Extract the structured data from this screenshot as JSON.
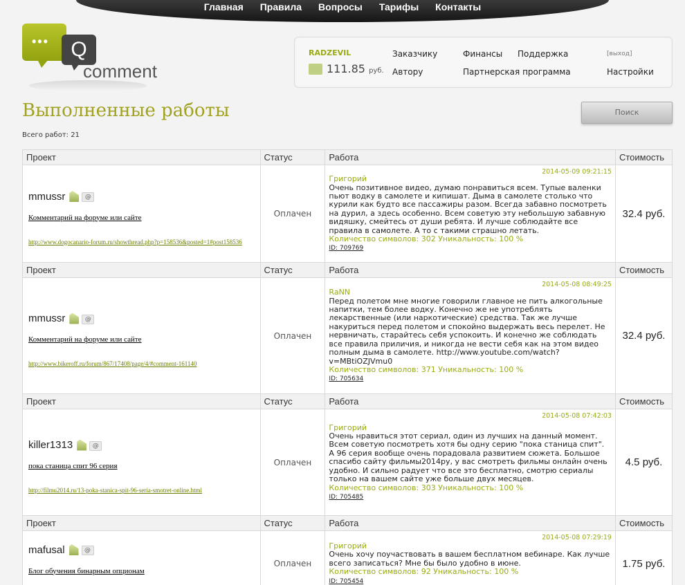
{
  "nav": [
    "Главная",
    "Правила",
    "Вопросы",
    "Тарифы",
    "Контакты"
  ],
  "logo": {
    "letter": "Q",
    "word": "comment",
    "dots": "•••"
  },
  "user": {
    "name": "RADZEVIL",
    "balance": "111.85",
    "currency": "руб.",
    "links": {
      "customer": "Заказчику",
      "author": "Автору",
      "finance": "Финансы",
      "partner": "Партнерская программа",
      "support": "Поддержка",
      "exit": "[выход]",
      "settings": "Настройки"
    }
  },
  "page": {
    "title": "Выполненные работы",
    "search_button": "Поиск",
    "total": "Всего работ: 21"
  },
  "headers": {
    "project": "Проект",
    "status": "Статус",
    "work": "Работа",
    "cost": "Стоимость"
  },
  "rows": [
    {
      "user": "mmussr",
      "title": "Комментарий на форуме или сайте",
      "link": "http://www.dogocanario-forum.ru/showthread.php?p=158536&posted=1#post158536",
      "status": "Оплачен",
      "author": "Григорий",
      "date": "2014-05-09 09:21:15",
      "text": "Очень позитивное видео, думаю понравиться всем. Тупые валенки пьют водку в самолете и кипишат. Дыма в самолете столько что курили как будто все пассажиры разом. Всегда забавно посмотреть на дурил, а здесь особенно. Всем советую эту небольшую забавную видяшку, смейтесь от души ребята. И лучше соблюдайте все правила в самолете. А то с такими страшно летать.",
      "stats": "Количество символов: 302 Уникальность: 100 %",
      "id": "ID: 709769",
      "price": "32.4 руб."
    },
    {
      "user": "mmussr",
      "title": "Комментарий на форуме или сайте",
      "link": "http://www.bikeroff.ru/forum/867/17408/page/4/#comment-161140",
      "status": "Оплачен",
      "author": "RaNN",
      "date": "2014-05-08 08:49:25",
      "text": "Перед полетом мне многие говорили главное не пить алкогольные напитки, тем более водку. Конечно же не употреблять лекарственные (или наркотические) средства. Так же лучше накуриться перед полетом и спокойно выдержать весь перелет. Не нервничать, старайтесь себя успокоить. И конечно же соблюдать все правила приличия, и никогда не вести себя как на этом видео полным дыма в самолете. http://www.youtube.com/watch?v=MBtiOZJVmu0",
      "stats": "Количество символов: 371 Уникальность: 100 %",
      "id": "ID: 705634",
      "price": "32.4 руб."
    },
    {
      "user": "killer1313",
      "title": "пока станица спит 96 серия",
      "link": "http://filmu2014.ru/13-poka-stanica-spit-96-seria-smotret-online.html",
      "status": "Оплачен",
      "author": "Григорий",
      "date": "2014-05-08 07:42:03",
      "text": "Очень нравиться этот сериал, один из лучших на данный момент. Всем советую посмотреть хотя бы одну серию \"пока станица спит\". А 96 серия вообще очень порадовала развитием сюжета. Большое спасибо сайту фильмы2014ру, у вас смотреть фильмы онлайн очень удобно. И сильно радует что все это бесплатно, смотрю сериалы только на вашем сайте уже больше двух месяцев.",
      "stats": "Количество символов: 303 Уникальность: 100 %",
      "id": "ID: 705485",
      "price": "4.5 руб."
    },
    {
      "user": "mafusal",
      "title": "Блог обучения бинарным опционам",
      "link": "",
      "status": "Оплачен",
      "author": "Григорий",
      "date": "2014-05-08 07:29:19",
      "text": "Очень хочу поучаствовать в вашем бесплатном вебинаре. Как лучше всего записаться? Мне бы было удобно в июне.",
      "stats": "Количество символов: 92 Уникальность: 100 %",
      "id": "ID: 705454",
      "price": "1.75 руб."
    }
  ]
}
